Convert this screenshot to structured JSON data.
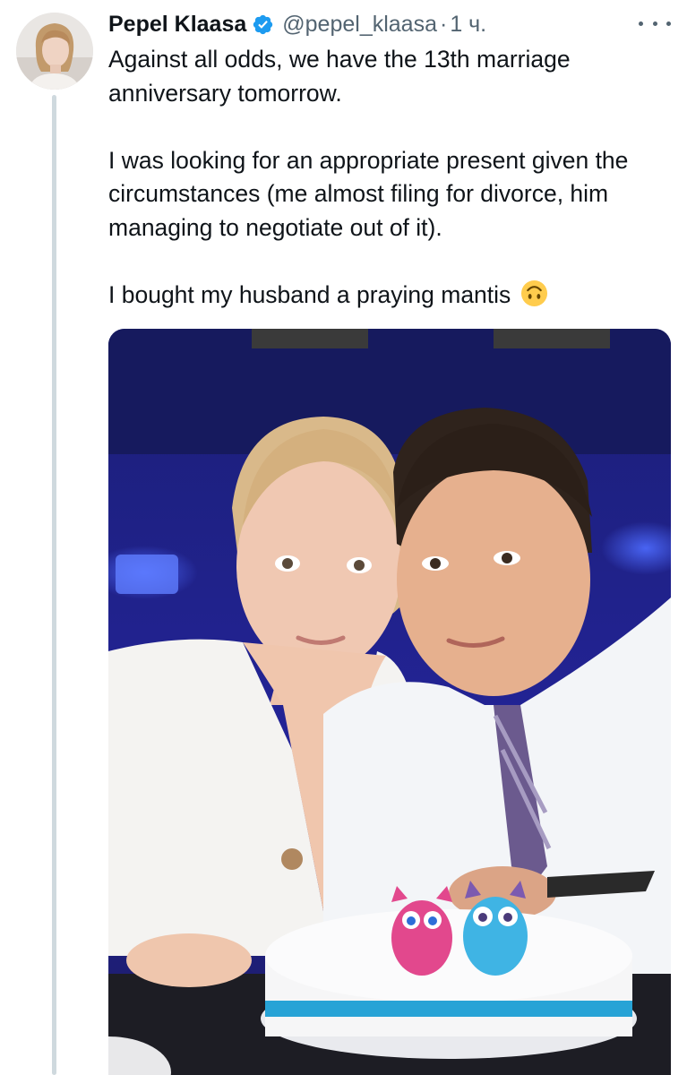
{
  "author": {
    "display_name": "Pepel Klaasa",
    "handle": "@pepel_klaasa",
    "separator": "·",
    "time": "1 ч."
  },
  "tweet": {
    "paragraphs": [
      "Against all odds, we have the 13th marriage anniversary tomorrow.",
      "I was looking for an appropriate present given the circumstances (me almost filing for divorce, him managing to negotiate out of it).",
      "I bought my husband a praying mantis"
    ],
    "emoji": "upside-down-face"
  },
  "icons": {
    "verified": "verified-badge-icon",
    "more": "more-options-icon"
  },
  "colors": {
    "verified_blue": "#1d9bf0",
    "secondary_text": "#536471",
    "thread_line": "#cfd9de"
  }
}
